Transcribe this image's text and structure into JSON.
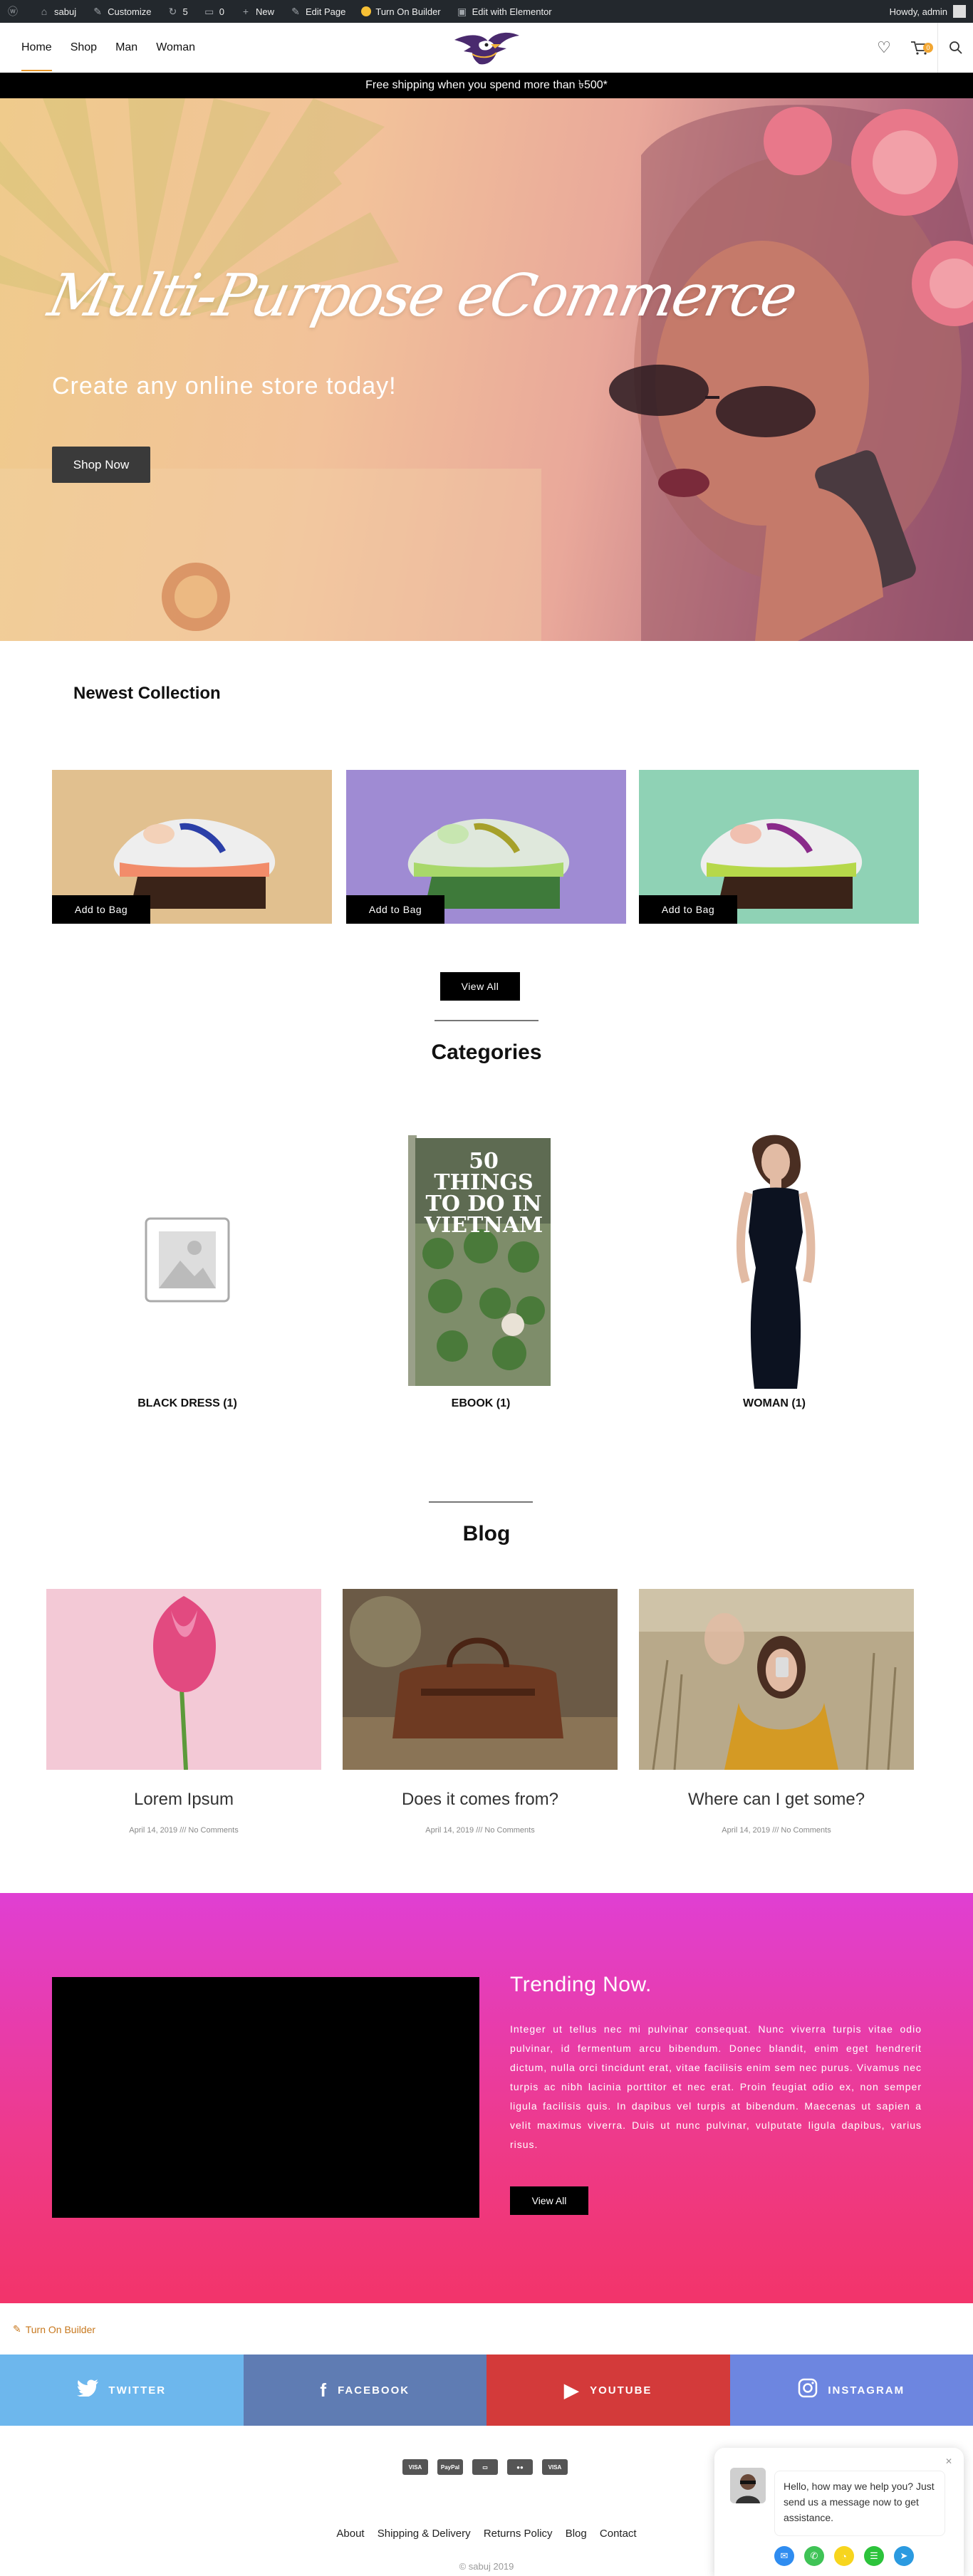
{
  "adminbar": {
    "items": [
      "sabuj",
      "Customize",
      "5",
      "0",
      "New",
      "Edit Page",
      "Turn On Builder",
      "Edit with Elementor"
    ],
    "greeting": "Howdy, admin"
  },
  "header": {
    "nav": [
      "Home",
      "Shop",
      "Man",
      "Woman"
    ],
    "cart_count": "0"
  },
  "notice": "Free shipping when you spend more than ৳500*",
  "hero": {
    "title": "Multi-Purpose eCommerce",
    "subtitle": "Create any online store today!",
    "button": "Shop Now"
  },
  "newest": {
    "title": "Newest Collection",
    "products": [
      {
        "button": "Add to Bag",
        "bg": "#e1c08f"
      },
      {
        "button": "Add to Bag",
        "bg": "#9f8bd3"
      },
      {
        "button": "Add to Bag",
        "bg": "#8fd2b5"
      }
    ],
    "view_all": "View All"
  },
  "categories": {
    "title": "Categories",
    "items": [
      {
        "label": "BLACK DRESS (1)"
      },
      {
        "label": "EBOOK (1)",
        "book_title": "50 THINGS TO DO IN VIETNAM"
      },
      {
        "label": "WOMAN (1)"
      }
    ]
  },
  "blog": {
    "title": "Blog",
    "posts": [
      {
        "title": "Lorem Ipsum",
        "meta": "April 14, 2019 /// No Comments"
      },
      {
        "title": "Does it comes from?",
        "meta": "April 14, 2019 /// No Comments"
      },
      {
        "title": "Where can I get some?",
        "meta": "April 14, 2019 /// No Comments"
      }
    ]
  },
  "trending": {
    "title": "Trending Now.",
    "text": "Integer ut tellus nec mi pulvinar consequat. Nunc viverra turpis vitae odio pulvinar, id fermentum arcu bibendum. Donec blandit, enim eget hendrerit dictum, nulla orci tincidunt erat, vitae facilisis enim sem nec purus. Vivamus nec turpis ac nibh lacinia porttitor et nec erat. Proin feugiat odio ex, non semper ligula facilisis quis. In dapibus vel turpis at bibendum. Maecenas ut sapien a velit maximus viverra. Duis ut nunc pulvinar, vulputate ligula dapibus, varius risus.",
    "button": "View All"
  },
  "turn_on_builder": "Turn On Builder",
  "social": [
    {
      "label": "TWITTER",
      "color": "#6db7ed"
    },
    {
      "label": "FACEBOOK",
      "color": "#5f7cb3"
    },
    {
      "label": "YOUTUBE",
      "color": "#d33a3a"
    },
    {
      "label": "INSTAGRAM",
      "color": "#6d86e0"
    }
  ],
  "payments": [
    "VISA",
    "PayPal",
    "",
    "",
    "VISA"
  ],
  "footer_links": [
    "About",
    "Shipping & Delivery",
    "Returns Policy",
    "Blog",
    "Contact"
  ],
  "copyright": "© sabuj 2019",
  "chat": {
    "message": "Hello, how may we help you? Just send us a message now to get assistance."
  }
}
